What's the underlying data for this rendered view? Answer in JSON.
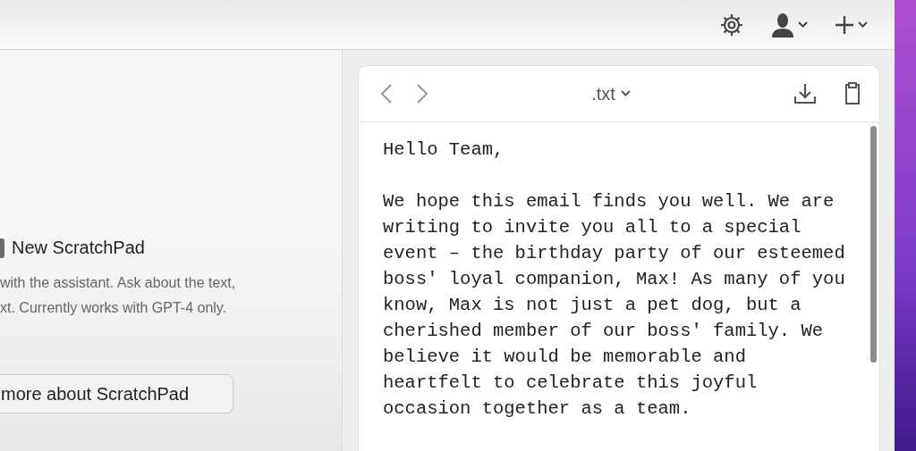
{
  "left_panel": {
    "title": "New ScratchPad",
    "description": "with the assistant. Ask about the text,\nxt. Currently works with GPT-4 only.",
    "button": "more about ScratchPad"
  },
  "editor": {
    "file_type": ".txt",
    "paragraphs": [
      "Hello Team,",
      "We hope this email finds you well. We are writing to invite you all to a special event – the birthday party of our esteemed boss' loyal companion, Max! As many of you know, Max is not just a pet dog, but a cherished member of our boss' family. We believe it would be memorable and heartfelt to celebrate this joyful occasion together as a team."
    ]
  }
}
